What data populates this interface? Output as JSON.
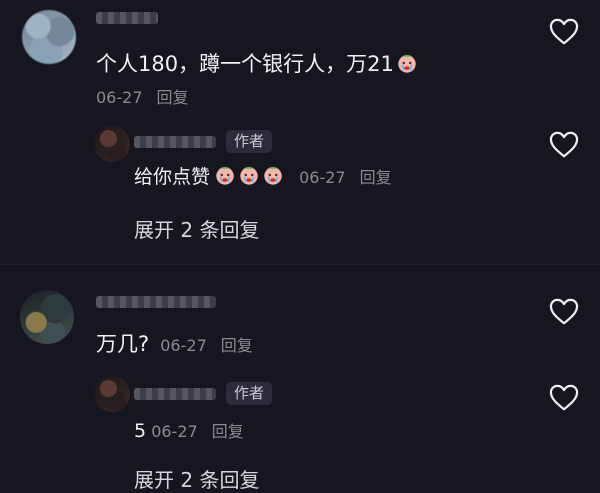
{
  "comments": [
    {
      "text": "个人180，蹲一个银行人，万21",
      "emoji": "crying-face-emoji",
      "date": "06-27",
      "reply_label": "回复",
      "replies": [
        {
          "author_badge": "作者",
          "text": "给你点赞",
          "emojis": [
            "crying-face-emoji",
            "crying-face-emoji",
            "crying-face-emoji"
          ],
          "date": "06-27",
          "reply_label": "回复"
        }
      ],
      "expand_label": "展开 2 条回复"
    },
    {
      "text": "万几?",
      "date": "06-27",
      "reply_label": "回复",
      "replies": [
        {
          "author_badge": "作者",
          "text": "5",
          "date": "06-27",
          "reply_label": "回复"
        }
      ],
      "expand_label": "展开 2 条回复"
    }
  ],
  "icons": {
    "like": "heart-outline-icon"
  },
  "colors": {
    "background": "#161621",
    "text": "#f1f1f5",
    "meta": "#8a8a96",
    "badge_bg": "#2d2d3a"
  }
}
